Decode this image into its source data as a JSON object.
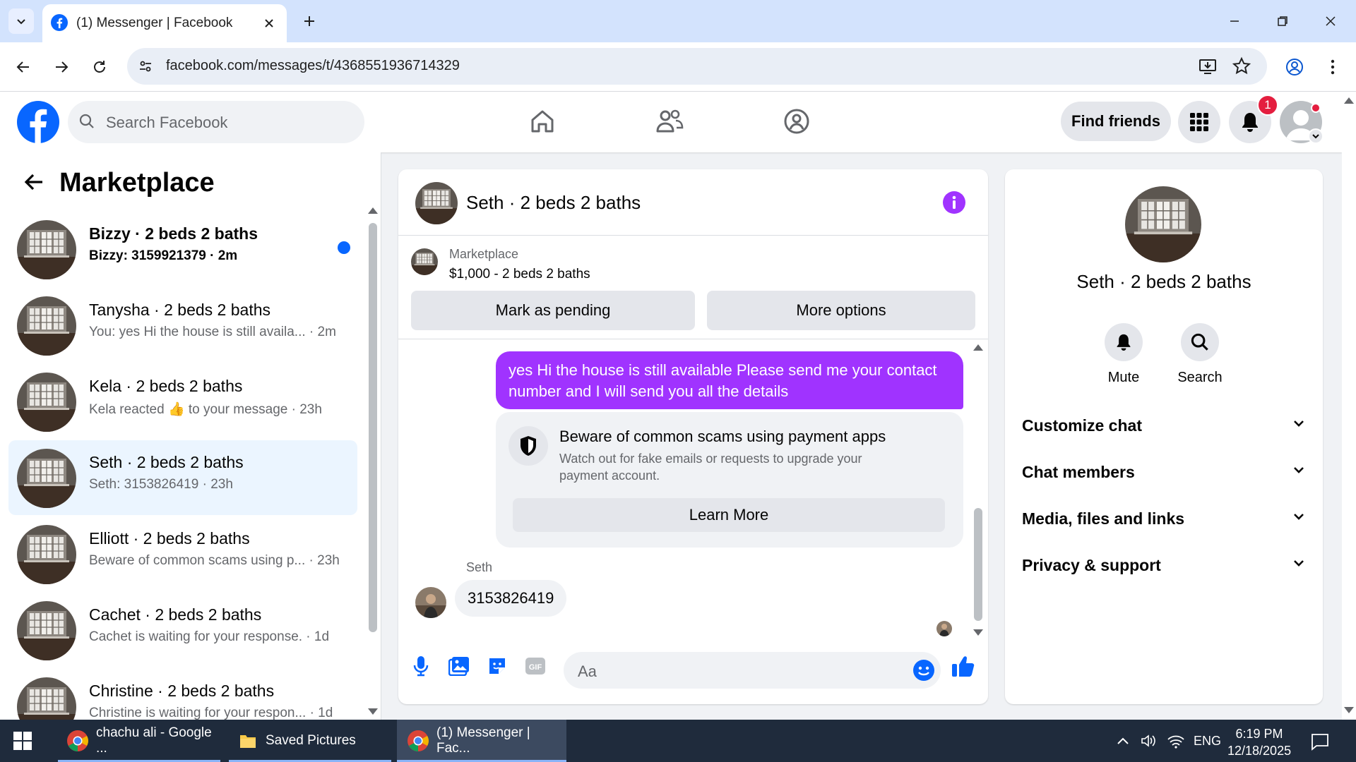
{
  "browser": {
    "tab_title": "(1) Messenger | Facebook",
    "url": "facebook.com/messages/t/4368551936714329"
  },
  "fb_header": {
    "search_placeholder": "Search Facebook",
    "find_friends": "Find friends",
    "notification_count": "1"
  },
  "sidebar": {
    "title": "Marketplace",
    "conversations": [
      {
        "name": "Bizzy · 2 beds 2 baths",
        "preview": "Bizzy: 3159921379 · 2m",
        "unread": true
      },
      {
        "name": "Tanysha · 2 beds 2 baths",
        "preview": "You: yes Hi the house is still availa... · 2m"
      },
      {
        "name": "Kela · 2 beds 2 baths",
        "preview": "Kela reacted 👍 to your message · 23h"
      },
      {
        "name": "Seth · 2 beds 2 baths",
        "preview": "Seth: 3153826419 · 23h",
        "selected": true
      },
      {
        "name": "Elliott · 2 beds 2 baths",
        "preview": "Beware of common scams using p... · 23h"
      },
      {
        "name": "Cachet · 2 beds 2 baths",
        "preview": "Cachet is waiting for your response. · 1d"
      },
      {
        "name": "Christine · 2 beds 2 baths",
        "preview": "Christine is waiting for your respon... · 1d"
      }
    ]
  },
  "chat": {
    "title": "Seth · 2 beds 2 baths",
    "listing_label": "Marketplace",
    "listing_price": "$1,000 - 2 beds 2 baths",
    "mark_pending": "Mark as pending",
    "more_options": "More options",
    "outgoing": "yes Hi the house is still available Please send me your contact number and I will send you all the details",
    "scam_title": "Beware of common scams using payment apps",
    "scam_body": "Watch out for fake emails or requests to upgrade your payment account.",
    "learn_more": "Learn More",
    "sender": "Seth",
    "incoming": "3153826419",
    "composer_placeholder": "Aa"
  },
  "info_panel": {
    "name": "Seth · 2 beds 2 baths",
    "mute": "Mute",
    "search": "Search",
    "sections": [
      "Customize chat",
      "Chat members",
      "Media, files and links",
      "Privacy & support"
    ]
  },
  "taskbar": {
    "items": [
      "chachu ali - Google ...",
      "Saved Pictures",
      "(1) Messenger | Fac..."
    ],
    "lang": "ENG",
    "time": "6:19 PM",
    "date": "12/18/2025"
  },
  "colors": {
    "fb_blue": "#0866ff",
    "messenger_purple": "#a033ff",
    "selected_bg": "#ebf5ff"
  }
}
